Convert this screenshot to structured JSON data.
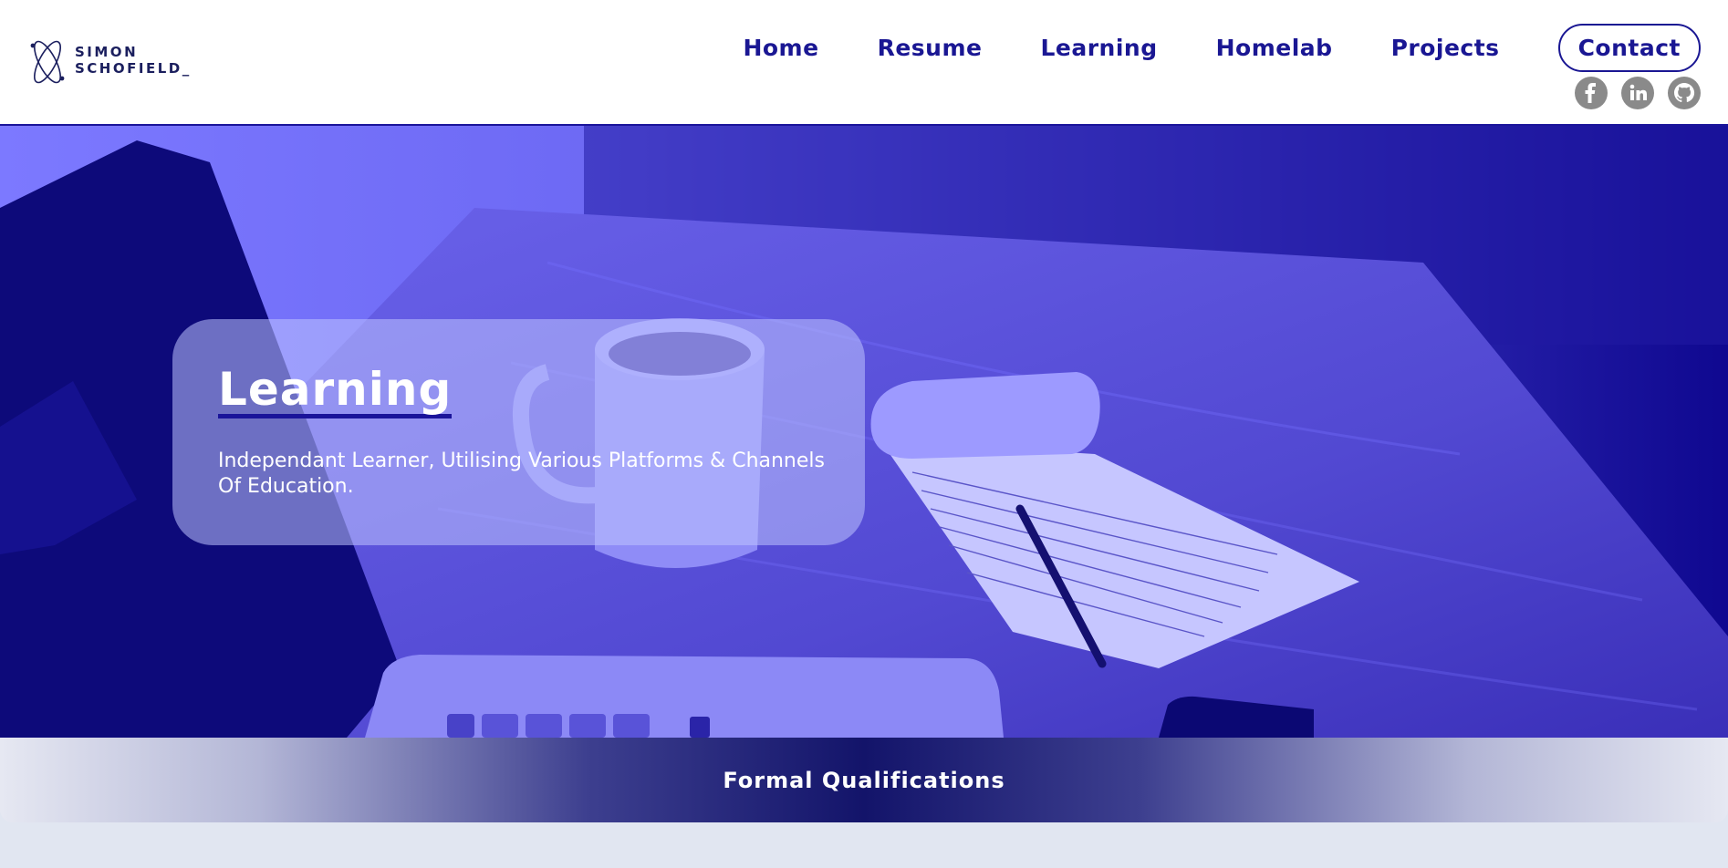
{
  "header": {
    "logo": {
      "line1": "Simon",
      "line2": "Schofield_"
    },
    "nav": [
      {
        "label": "Home"
      },
      {
        "label": "Resume"
      },
      {
        "label": "Learning"
      },
      {
        "label": "Homelab"
      },
      {
        "label": "Projects"
      }
    ],
    "contact_label": "Contact",
    "socials": [
      {
        "icon": "facebook-icon"
      },
      {
        "icon": "linkedin-icon"
      },
      {
        "icon": "github-icon"
      }
    ]
  },
  "hero": {
    "title": "Learning",
    "subtitle": "Independant Learner, Utilising Various Platforms & Channels Of Education."
  },
  "section": {
    "title": "Formal Qualifications"
  },
  "colors": {
    "brand": "#1a1793",
    "hero_tint": "#1a0f9a",
    "page_bg": "#e1e6f1"
  }
}
